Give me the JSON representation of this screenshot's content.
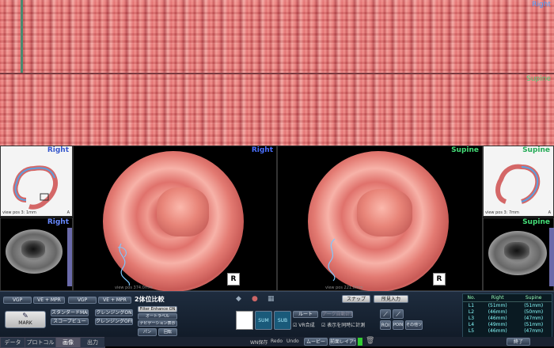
{
  "strips": {
    "top_label": "Right",
    "bottom_label": "Supine"
  },
  "views": {
    "left_title": "Right",
    "right_title": "Supine",
    "left_overview_title": "Right",
    "right_overview_title": "Supine",
    "left_axial_title": "Right",
    "right_axial_title": "Supine",
    "orientation_marker": "R",
    "overview_caption_left": "view pos 3: 1mm",
    "overview_caption_right": "view pos 3: 7mm",
    "axis_letter": "A",
    "bottom_caption_left": "view pos 374.0mm",
    "bottom_caption_right": "view pos 221.0mm"
  },
  "toolbar": {
    "vgp_left": "VGP",
    "ve_mpr_left": "VE + MPR",
    "vgp_right": "VGP",
    "ve_mpr_right": "VE + MPR",
    "compare_title": "2体位比較",
    "mark": "MARK",
    "standard_mark": "スタンダードMARK",
    "scope_view": "スコープビュー",
    "cleansing_on": "クレンジングON",
    "cleansing_off": "クレンジングOFF",
    "filter_enhance": "Filter Enhance ON",
    "auto_label": "オートラベル",
    "navigation_display": "ナビゲーション表示",
    "ctrl_a": "パン",
    "ctrl_b": "回転",
    "route": "ルート",
    "auto_curve": "アーク自動計算",
    "sum": "SUM",
    "vr_sync": "VR合成",
    "link_calc": "表示を同時に計測",
    "snap": "スナップ",
    "findings": "所見入力",
    "roi": "ROI",
    "point": "POINT",
    "sub1": "その他ツール"
  },
  "results_table": {
    "headers": [
      "No.",
      "Right",
      "Supine"
    ],
    "rows": [
      [
        "L1",
        "(51mm)",
        "(51mm)"
      ],
      [
        "L2",
        "(46mm)",
        "(50mm)"
      ],
      [
        "L3",
        "(46mm)",
        "(47mm)"
      ],
      [
        "L4",
        "(49mm)",
        "(51mm)"
      ],
      [
        "L5",
        "(46mm)",
        "(47mm)"
      ]
    ]
  },
  "tabs": [
    "データ",
    "プロトコル",
    "画像",
    "出力"
  ],
  "status": {
    "wn_save": "WN保存",
    "redo": "Redo",
    "undo": "Undo",
    "movie": "ムービー",
    "layout": "前面レイアウト",
    "end": "終了"
  }
}
